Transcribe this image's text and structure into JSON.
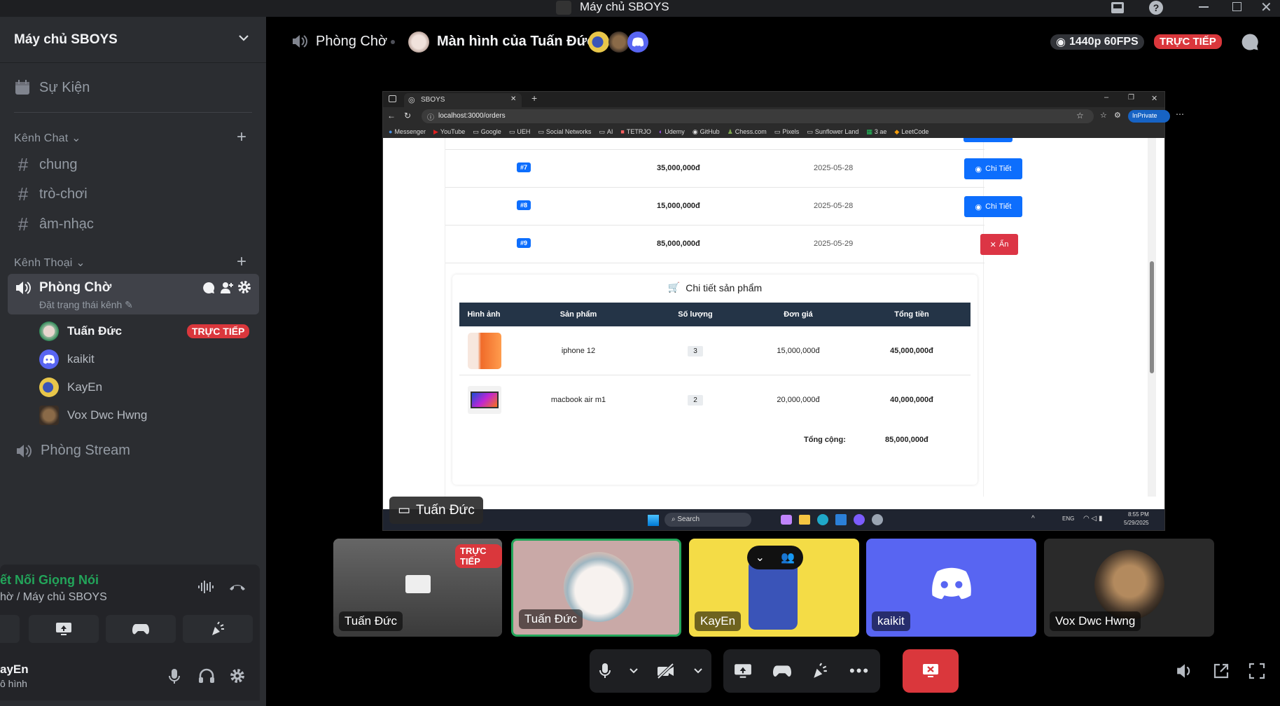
{
  "window": {
    "title": "Máy chủ SBOYS"
  },
  "server": {
    "name": "Máy chủ SBOYS"
  },
  "sidebar": {
    "events": "Sự Kiện",
    "text_category": "Kênh Chat",
    "text_channels": [
      "chung",
      "trò-chơi",
      "âm-nhạc"
    ],
    "voice_category": "Kênh Thoại",
    "voice_channel": {
      "name": "Phòng Chờ",
      "status": "Đặt trạng thái kênh"
    },
    "voice_users": [
      {
        "name": "Tuấn Đức",
        "badge": "TRỰC TIẾP"
      },
      {
        "name": "kaikit"
      },
      {
        "name": "KayEn"
      },
      {
        "name": "Vox Dwc Hwng"
      }
    ],
    "voice_channel_2": "Phòng Stream"
  },
  "voice_panel": {
    "title": "ết Nối Giọng Nói",
    "subtitle": "hờ / Máy chủ SBOYS"
  },
  "user_panel": {
    "name": "ayEn",
    "status": "ô hình"
  },
  "header": {
    "channel": "Phòng Chờ",
    "screen_title": "Màn hình của Tuấn Đức",
    "quality": "1440p 60FPS",
    "live": "TRỰC TIẾP"
  },
  "share": {
    "tab_title": "SBOYS",
    "url": "localhost:3000/orders",
    "inprivate": "InPrivate",
    "bookmarks": [
      "Messenger",
      "YouTube",
      "Google",
      "UEH",
      "Social Networks",
      "AI",
      "TETRJO",
      "Udemy",
      "GitHub",
      "Chess.com",
      "Pixels",
      "Sunflower Land",
      "3 ae",
      "LeetCode"
    ],
    "orders": [
      {
        "id": "#7",
        "total": "35,000,000đ",
        "date": "2025-05-28",
        "action": "Chi Tiết"
      },
      {
        "id": "#8",
        "total": "15,000,000đ",
        "date": "2025-05-28",
        "action": "Chi Tiết"
      },
      {
        "id": "#9",
        "total": "85,000,000đ",
        "date": "2025-05-29",
        "action": "Ẩn"
      }
    ],
    "detail_title": "Chi tiết sản phẩm",
    "detail_headers": [
      "Hình ảnh",
      "Sản phẩm",
      "Số lượng",
      "Đơn giá",
      "Tổng tiền"
    ],
    "detail_rows": [
      {
        "product": "iphone 12",
        "qty": "3",
        "price": "15,000,000đ",
        "total": "45,000,000đ"
      },
      {
        "product": "macbook air m1",
        "qty": "2",
        "price": "20,000,000đ",
        "total": "40,000,000đ"
      }
    ],
    "grand_label": "Tổng cộng:",
    "grand_total": "85,000,000đ",
    "taskbar": {
      "search": "Search",
      "lang": "ENG",
      "time": "8:55 PM",
      "date": "5/29/2025"
    },
    "presenter": "Tuấn Đức"
  },
  "tiles": [
    {
      "name": "Tuấn Đức",
      "badge": "TRỰC TIẾP"
    },
    {
      "name": "Tuấn Đức"
    },
    {
      "name": "KayEn"
    },
    {
      "name": "kaikit"
    },
    {
      "name": "Vox Dwc Hwng"
    }
  ],
  "colors": {
    "accent": "#5865f2",
    "live": "#da373c",
    "connected": "#23a55a",
    "speaking": "#23a55a"
  }
}
